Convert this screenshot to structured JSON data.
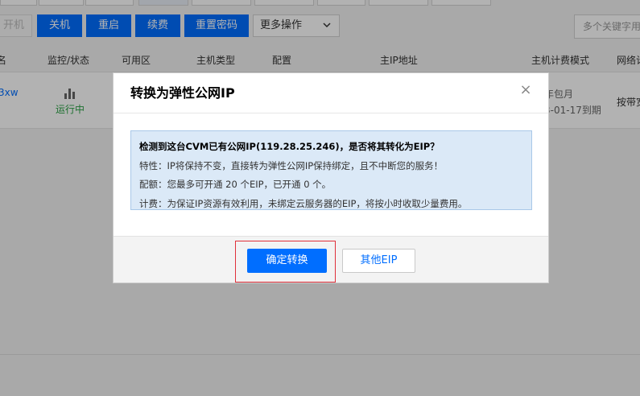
{
  "toolbar": {
    "poweron_label": "开机",
    "shutdown_label": "关机",
    "restart_label": "重启",
    "renew_label": "续费",
    "reset_password_label": "重置密码",
    "more_actions_label": "更多操作",
    "search_placeholder": "多个关键字用"
  },
  "table": {
    "headers": [
      "名",
      "监控/状态",
      "可用区",
      "主机类型",
      "配置",
      "主IP地址",
      "主机计费模式",
      "网络计"
    ],
    "row": {
      "id_fragment": "3xw",
      "status": "运行中",
      "billing_mode": "年包月",
      "expire": "3-01-17到期",
      "network_billing": "按带宽"
    }
  },
  "dialog": {
    "title": "转换为弹性公网IP",
    "close_symbol": "×",
    "notice": {
      "headline": "检测到这台CVM已有公网IP(119.28.25.246)，是否将其转化为EIP？",
      "feature": "特性：IP将保持不变，直接转为弹性公网IP保持绑定，且不中断您的服务！",
      "quota": "配额：您最多可开通 20 个EIP，已开通 0 个。",
      "billing": "计费：为保证IP资源有效利用，未绑定云服务器的EIP，将按小时收取少量费用。"
    },
    "confirm_label": "确定转换",
    "other_label": "其他EIP"
  },
  "colors": {
    "primary": "#006eff",
    "notice_bg": "#dbe9f7",
    "notice_border": "#a9c8e8",
    "highlight": "#e0303a",
    "status_running": "#2ba245"
  }
}
